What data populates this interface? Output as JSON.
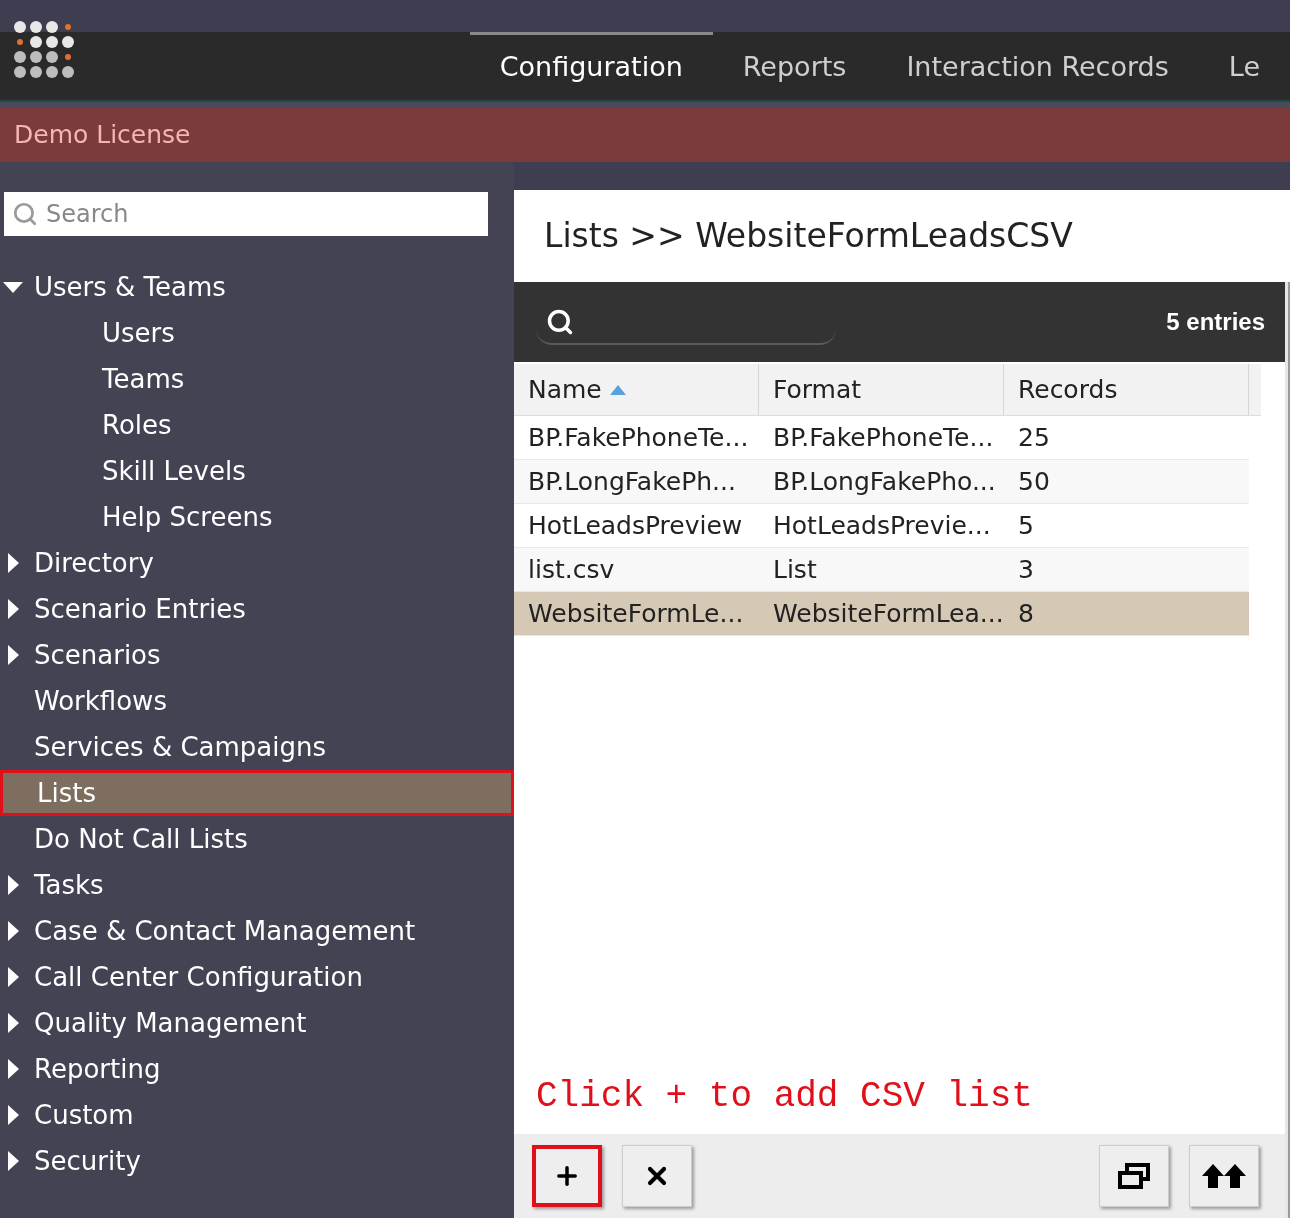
{
  "nav": {
    "tabs": [
      {
        "label": "Configuration",
        "selected": true
      },
      {
        "label": "Reports",
        "selected": false
      },
      {
        "label": "Interaction Records",
        "selected": false
      },
      {
        "label": "Le",
        "selected": false
      }
    ]
  },
  "license_banner": "Demo License",
  "sidebar": {
    "search": {
      "placeholder": "Search"
    },
    "items": [
      {
        "label": "Users & Teams",
        "expanded": true,
        "selected": false,
        "children": [
          {
            "label": "Users",
            "selected": false
          },
          {
            "label": "Teams",
            "selected": false
          },
          {
            "label": "Roles",
            "selected": false
          },
          {
            "label": "Skill Levels",
            "selected": false
          },
          {
            "label": "Help Screens",
            "selected": false
          }
        ]
      },
      {
        "label": "Directory",
        "expanded": false,
        "selected": false
      },
      {
        "label": "Scenario Entries",
        "expanded": false,
        "selected": false
      },
      {
        "label": "Scenarios",
        "expanded": false,
        "selected": false
      },
      {
        "label": "Workflows",
        "selected": false
      },
      {
        "label": "Services & Campaigns",
        "selected": false
      },
      {
        "label": "Lists",
        "selected": true
      },
      {
        "label": "Do Not Call Lists",
        "selected": false
      },
      {
        "label": "Tasks",
        "expanded": false,
        "selected": false
      },
      {
        "label": "Case & Contact Management",
        "expanded": false,
        "selected": false
      },
      {
        "label": "Call Center Configuration",
        "expanded": false,
        "selected": false
      },
      {
        "label": "Quality Management",
        "expanded": false,
        "selected": false
      },
      {
        "label": "Reporting",
        "expanded": false,
        "selected": false
      },
      {
        "label": "Custom",
        "expanded": false,
        "selected": false
      },
      {
        "label": "Security",
        "expanded": false,
        "selected": false
      }
    ]
  },
  "content": {
    "title": "Lists >> WebsiteFormLeadsCSV",
    "entries": "5 entries",
    "table": {
      "columns": [
        {
          "label": "Name",
          "sorted": true
        },
        {
          "label": "Format",
          "sorted": false
        },
        {
          "label": "Records",
          "sorted": false
        }
      ],
      "rows": [
        {
          "cells": [
            "BP.FakePhoneTe...",
            "BP.FakePhoneTe...",
            "25"
          ],
          "selected": false
        },
        {
          "cells": [
            "BP.LongFakePh...",
            "BP.LongFakePho...",
            "50"
          ],
          "selected": false
        },
        {
          "cells": [
            "HotLeadsPreview",
            "HotLeadsPrevie...",
            "5"
          ],
          "selected": false
        },
        {
          "cells": [
            "list.csv",
            "List",
            "3"
          ],
          "selected": false
        },
        {
          "cells": [
            "WebsiteFormLe...",
            "WebsiteFormLea...",
            "8"
          ],
          "selected": true
        }
      ]
    },
    "annotation": "Click + to add CSV list",
    "buttons": [
      {
        "kind": "add",
        "outlined": true
      },
      {
        "kind": "delete",
        "outlined": false
      },
      {
        "kind": "window",
        "outlined": false
      },
      {
        "kind": "top",
        "outlined": false
      }
    ]
  }
}
